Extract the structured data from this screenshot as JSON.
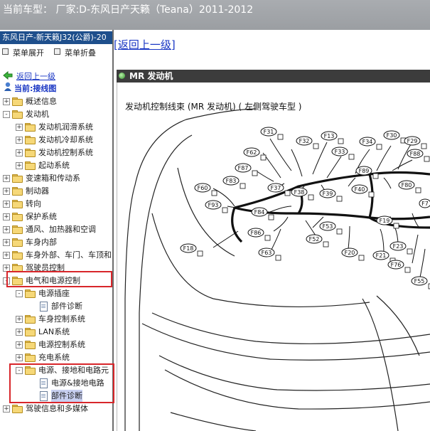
{
  "topbar": {
    "title": "当前车型：  厂家:D-东风日产天籁（Teana）2011-2012"
  },
  "sidebar": {
    "header": "东风日产-新天籁J32(公爵)-20",
    "expand_label": "菜单展开",
    "collapse_label": "菜单折叠",
    "back_label": "返回上一级",
    "current_label": "当前:接线图",
    "tree": [
      {
        "label": "概述信息",
        "level": 0,
        "toggle": "+",
        "type": "folder"
      },
      {
        "label": "发动机",
        "level": 0,
        "toggle": "-",
        "type": "folder"
      },
      {
        "label": "发动机润滑系统",
        "level": 1,
        "toggle": "+",
        "type": "folder"
      },
      {
        "label": "发动机冷却系统",
        "level": 1,
        "toggle": "+",
        "type": "folder"
      },
      {
        "label": "发动机控制系统",
        "level": 1,
        "toggle": "+",
        "type": "folder"
      },
      {
        "label": "起动系统",
        "level": 1,
        "toggle": "+",
        "type": "folder"
      },
      {
        "label": "变速箱和传动系",
        "level": 0,
        "toggle": "+",
        "type": "folder"
      },
      {
        "label": "制动器",
        "level": 0,
        "toggle": "+",
        "type": "folder"
      },
      {
        "label": "转向",
        "level": 0,
        "toggle": "+",
        "type": "folder"
      },
      {
        "label": "保护系统",
        "level": 0,
        "toggle": "+",
        "type": "folder"
      },
      {
        "label": "通风、加热器和空调",
        "level": 0,
        "toggle": "+",
        "type": "folder"
      },
      {
        "label": "车身内部",
        "level": 0,
        "toggle": "+",
        "type": "folder"
      },
      {
        "label": "车身外部、车门、车顶和",
        "level": 0,
        "toggle": "+",
        "type": "folder"
      },
      {
        "label": "驾驶员控制",
        "level": 0,
        "toggle": "+",
        "type": "folder"
      },
      {
        "label": "电气和电源控制",
        "level": 0,
        "toggle": "-",
        "type": "folder"
      },
      {
        "label": "电源插座",
        "level": 1,
        "toggle": "-",
        "type": "folder"
      },
      {
        "label": "部件诊断",
        "level": 2,
        "toggle": "",
        "type": "doc"
      },
      {
        "label": "车身控制系统",
        "level": 1,
        "toggle": "+",
        "type": "folder"
      },
      {
        "label": "LAN系统",
        "level": 1,
        "toggle": "+",
        "type": "folder"
      },
      {
        "label": "电源控制系统",
        "level": 1,
        "toggle": "+",
        "type": "folder"
      },
      {
        "label": "充电系统",
        "level": 1,
        "toggle": "+",
        "type": "folder"
      },
      {
        "label": "电源、接地和电路元",
        "level": 1,
        "toggle": "-",
        "type": "folder"
      },
      {
        "label": "电源&接地电路",
        "level": 2,
        "toggle": "",
        "type": "doc"
      },
      {
        "label": "部件诊断",
        "level": 2,
        "toggle": "",
        "type": "doc",
        "selected": true
      },
      {
        "label": "驾驶信息和多媒体",
        "level": 0,
        "toggle": "+",
        "type": "folder"
      }
    ]
  },
  "main": {
    "back_link": "[返回上一级]",
    "panel_title": "MR 发动机",
    "diagram_title": "发动机控制线束 (MR 发动机) ( 左侧驾驶车型 )"
  },
  "connectors": [
    "F31",
    "F32",
    "F13",
    "F33",
    "F34",
    "F30",
    "F29",
    "F88",
    "F62",
    "F87",
    "F89",
    "F83",
    "F37",
    "F38",
    "F39",
    "F40",
    "F80",
    "F60",
    "F93",
    "F84",
    "F7",
    "F19",
    "F53",
    "F86",
    "F52",
    "F23",
    "F18",
    "F63",
    "F20",
    "F21",
    "F76",
    "F55"
  ]
}
